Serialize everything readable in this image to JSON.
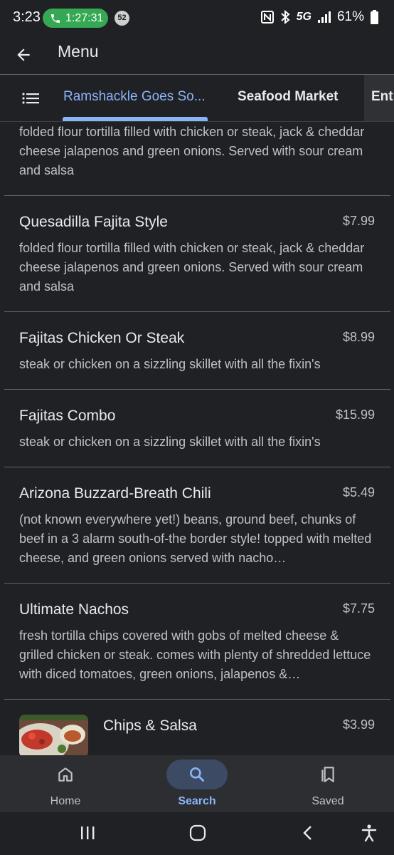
{
  "status_bar": {
    "time": "3:23",
    "call_timer": "1:27:31",
    "notification_count": "52",
    "network": "5G",
    "battery": "61%"
  },
  "app_bar": {
    "title": "Menu",
    "back_icon": "arrow-back-icon"
  },
  "tabs": {
    "list_icon": "list-icon",
    "items": [
      {
        "label": "Ramshackle Goes So...",
        "active": true
      },
      {
        "label": "Seafood Market",
        "active": false
      },
      {
        "label": "Entr",
        "active": false
      }
    ]
  },
  "menu": {
    "partial_description": "folded flour tortilla filled with chicken or steak, jack & cheddar cheese jalapenos and green onions. Served with sour cream and salsa",
    "items": [
      {
        "name": "Quesadilla Fajita Style",
        "price": "$7.99",
        "description": "folded flour tortilla filled with chicken or steak, jack & cheddar cheese jalapenos and green onions. Served with sour cream and salsa"
      },
      {
        "name": "Fajitas Chicken Or Steak",
        "price": "$8.99",
        "description": "steak or chicken on a sizzling skillet with all the fixin's"
      },
      {
        "name": "Fajitas Combo",
        "price": "$15.99",
        "description": "steak or chicken on a sizzling skillet with all the fixin's"
      },
      {
        "name": "Arizona Buzzard-Breath Chili",
        "price": "$5.49",
        "description": "(not known everywhere yet!) beans, ground beef, chunks of beef in a 3 alarm south-of-the border style! topped with melted cheese, and green onions served with nacho…"
      },
      {
        "name": "Ultimate Nachos",
        "price": "$7.75",
        "description": "fresh tortilla chips covered with gobs of melted cheese & grilled chicken or steak. comes with plenty of shredded lettuce with diced tomatoes, green onions, jalapenos &…"
      },
      {
        "name": "Chips & Salsa",
        "price": "$3.99",
        "description": ""
      }
    ]
  },
  "bottom_nav": {
    "items": [
      {
        "label": "Home",
        "icon": "home-icon",
        "active": false
      },
      {
        "label": "Search",
        "icon": "search-icon",
        "active": true
      },
      {
        "label": "Saved",
        "icon": "bookmarks-icon",
        "active": false
      }
    ]
  },
  "colors": {
    "background": "#202124",
    "accent": "#8ab4f8",
    "call_green": "#34a853",
    "nav_background": "#2d2e31"
  }
}
